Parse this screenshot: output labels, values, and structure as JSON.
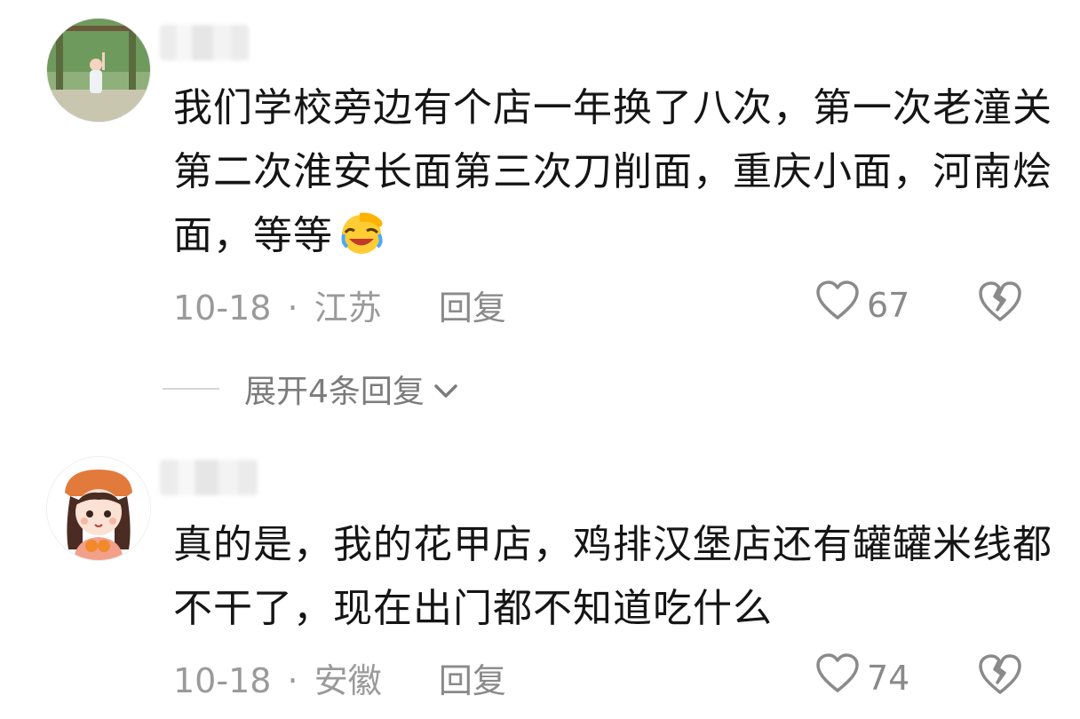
{
  "comments": [
    {
      "text": "我们学校旁边有个店一年换了八次，第一次老潼关第二次淮安长面第三次刀削面，重庆小面，河南烩面，等等",
      "emoji": "facepalm-laughing-emoji",
      "date": "10-18",
      "separator": "·",
      "location": "江苏",
      "reply_label": "回复",
      "likes": "67"
    },
    {
      "text": "真的是，我的花甲店，鸡排汉堡店还有罐罐米线都不干了，现在出门都不知道吃什么",
      "date": "10-18",
      "separator": "·",
      "location": "安徽",
      "reply_label": "回复",
      "likes": "74"
    }
  ],
  "expand_replies": {
    "label": "展开4条回复"
  },
  "colors": {
    "text": "#151515",
    "meta": "#9a9a9a",
    "icon": "#8a8a8a",
    "emoji": "#ffcc33"
  }
}
